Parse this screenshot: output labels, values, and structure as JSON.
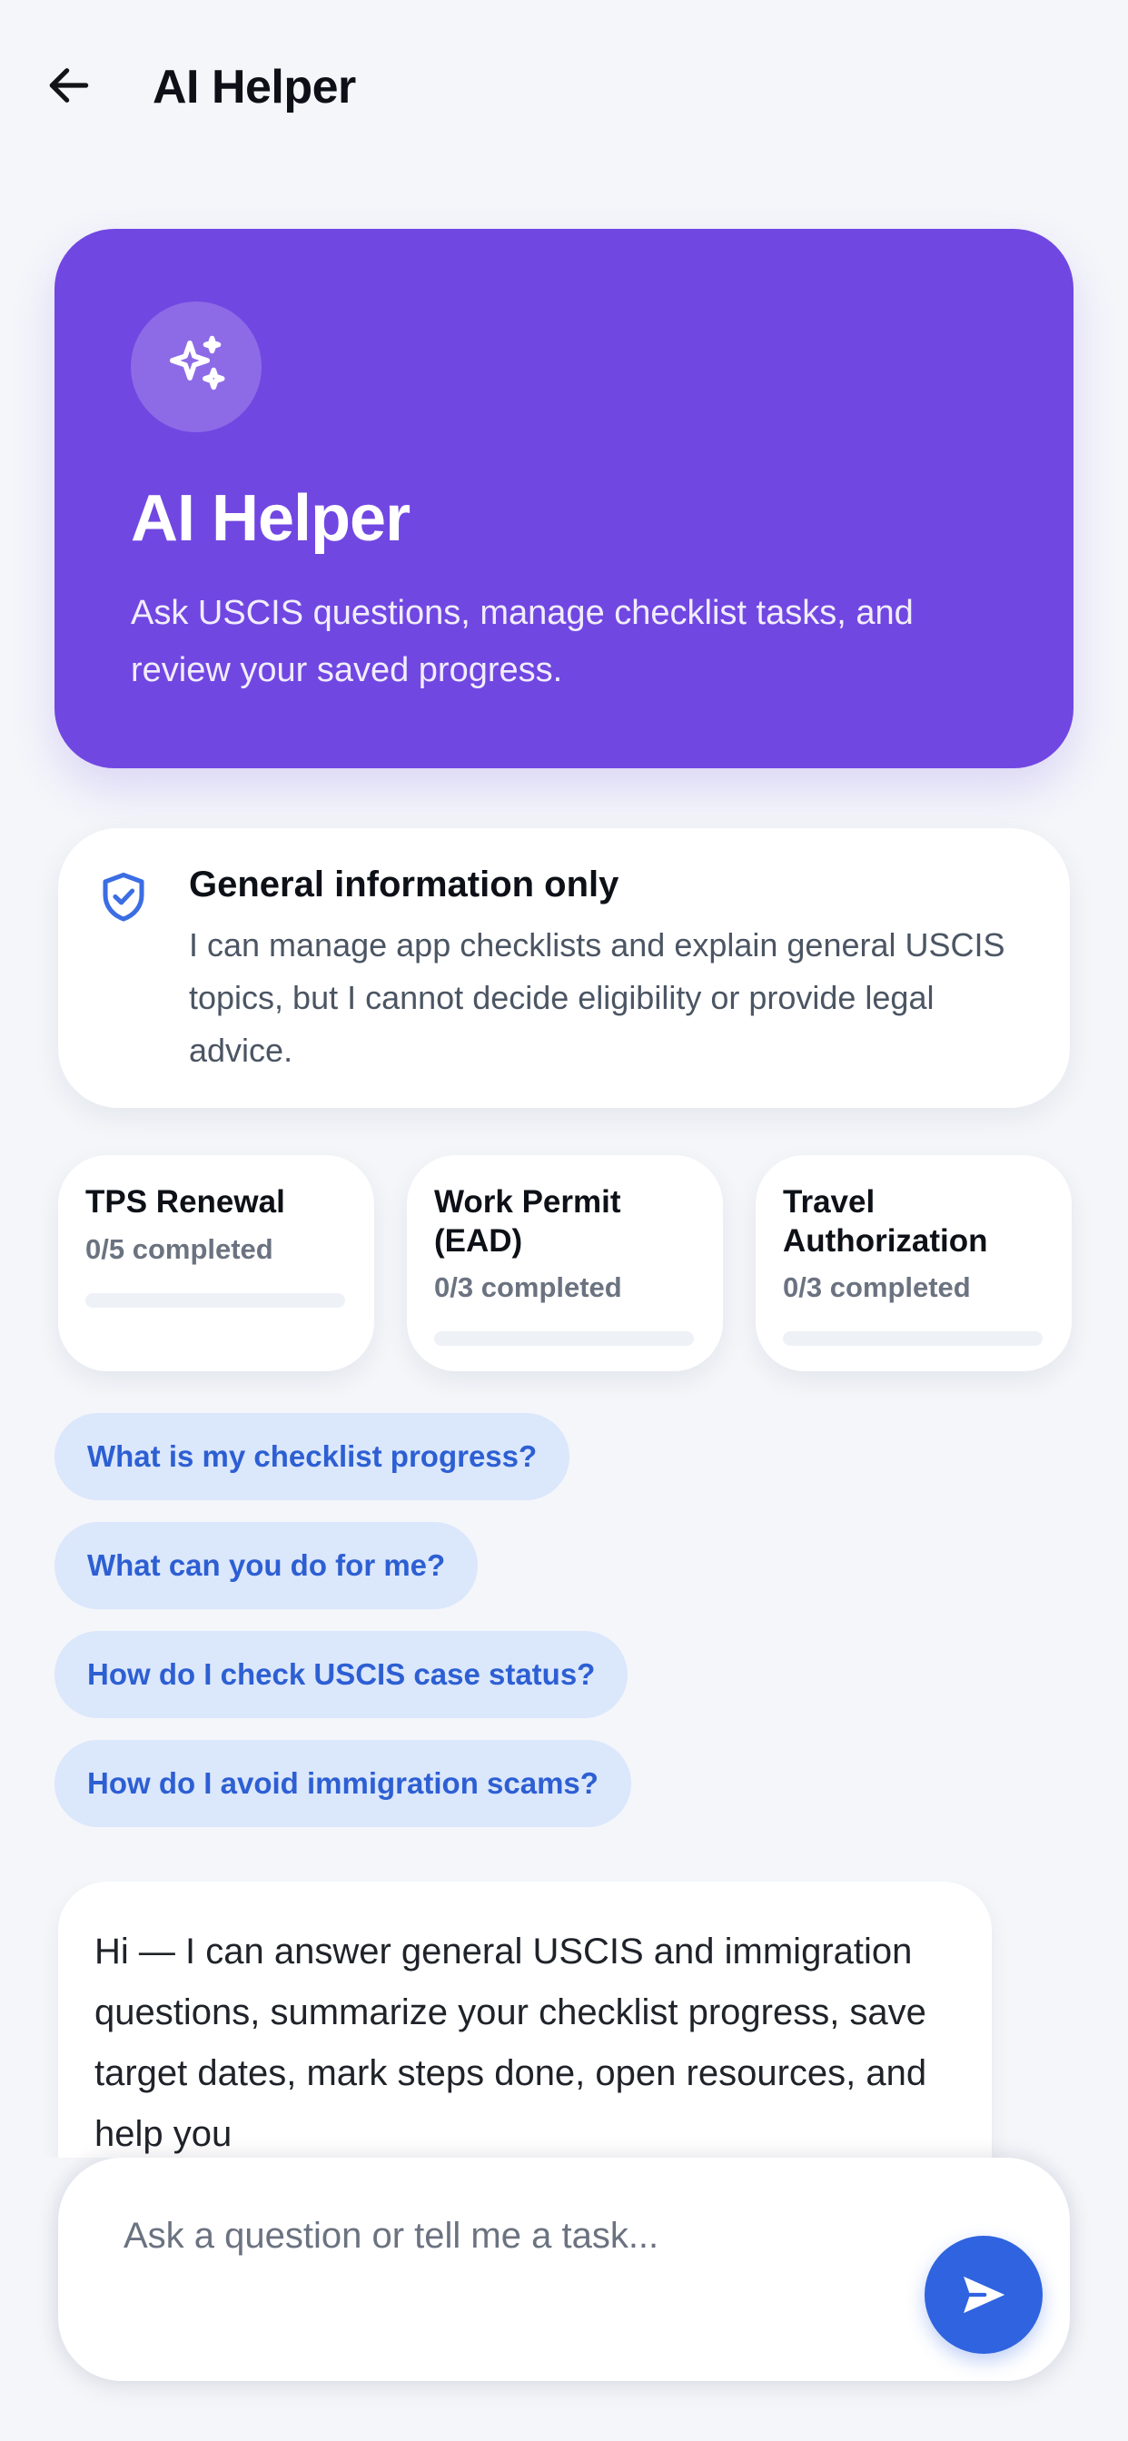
{
  "header": {
    "title": "AI Helper",
    "back_icon": "arrow-left-icon"
  },
  "hero": {
    "icon": "sparkles-icon",
    "title": "AI Helper",
    "subtitle": "Ask USCIS questions, manage checklist tasks, and review your saved progress."
  },
  "notice": {
    "icon": "shield-check-icon",
    "title": "General information only",
    "body": "I can manage app checklists and explain general USCIS topics, but I cannot decide eligibility or provide legal advice."
  },
  "checklists": [
    {
      "title": "TPS Renewal",
      "count": "0/5 completed",
      "progress": 0
    },
    {
      "title": "Work Permit (EAD)",
      "count": "0/3 completed",
      "progress": 0
    },
    {
      "title": "Travel Authorization",
      "count": "0/3 completed",
      "progress": 0
    }
  ],
  "suggestions": [
    "What is my checklist progress?",
    "What can you do for me?",
    "How do I check USCIS case status?",
    "How do I avoid immigration scams?"
  ],
  "messages": [
    {
      "role": "assistant",
      "text": "Hi — I can answer general USCIS and immigration questions, summarize your checklist progress, save target dates, mark steps done, open resources, and help you"
    }
  ],
  "composer": {
    "placeholder": "Ask a question or tell me a task...",
    "value": "",
    "send_icon": "send-icon"
  },
  "colors": {
    "background": "#f4f6fa",
    "hero": "#7147e2",
    "accent": "#2f63e0",
    "chip_bg": "#dbe7fb",
    "chip_text": "#2d5fd3"
  }
}
